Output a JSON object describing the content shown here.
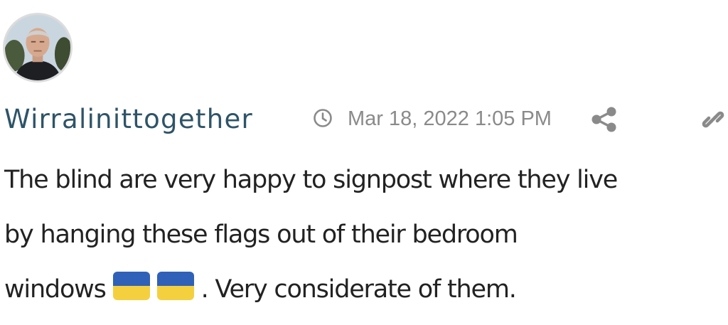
{
  "post": {
    "author": "Wirralinittogether",
    "timestamp": "Mar 18, 2022 1:05 PM",
    "text_line1": "The blind are very happy to signpost where they live",
    "text_line2": "by hanging these flags out of their bedroom",
    "text_line3_start": "windows",
    "text_line3_end": ". Very considerate of them.",
    "emoji": [
      "flag-ukraine",
      "flag-ukraine"
    ]
  },
  "icons": {
    "clock": "clock-icon",
    "share": "share-icon",
    "link": "link-icon"
  },
  "colors": {
    "author": "#2e5468",
    "meta": "#8a8a8a",
    "text": "#222222",
    "flag_blue": "#2f61b8",
    "flag_yellow": "#f4d03f"
  }
}
